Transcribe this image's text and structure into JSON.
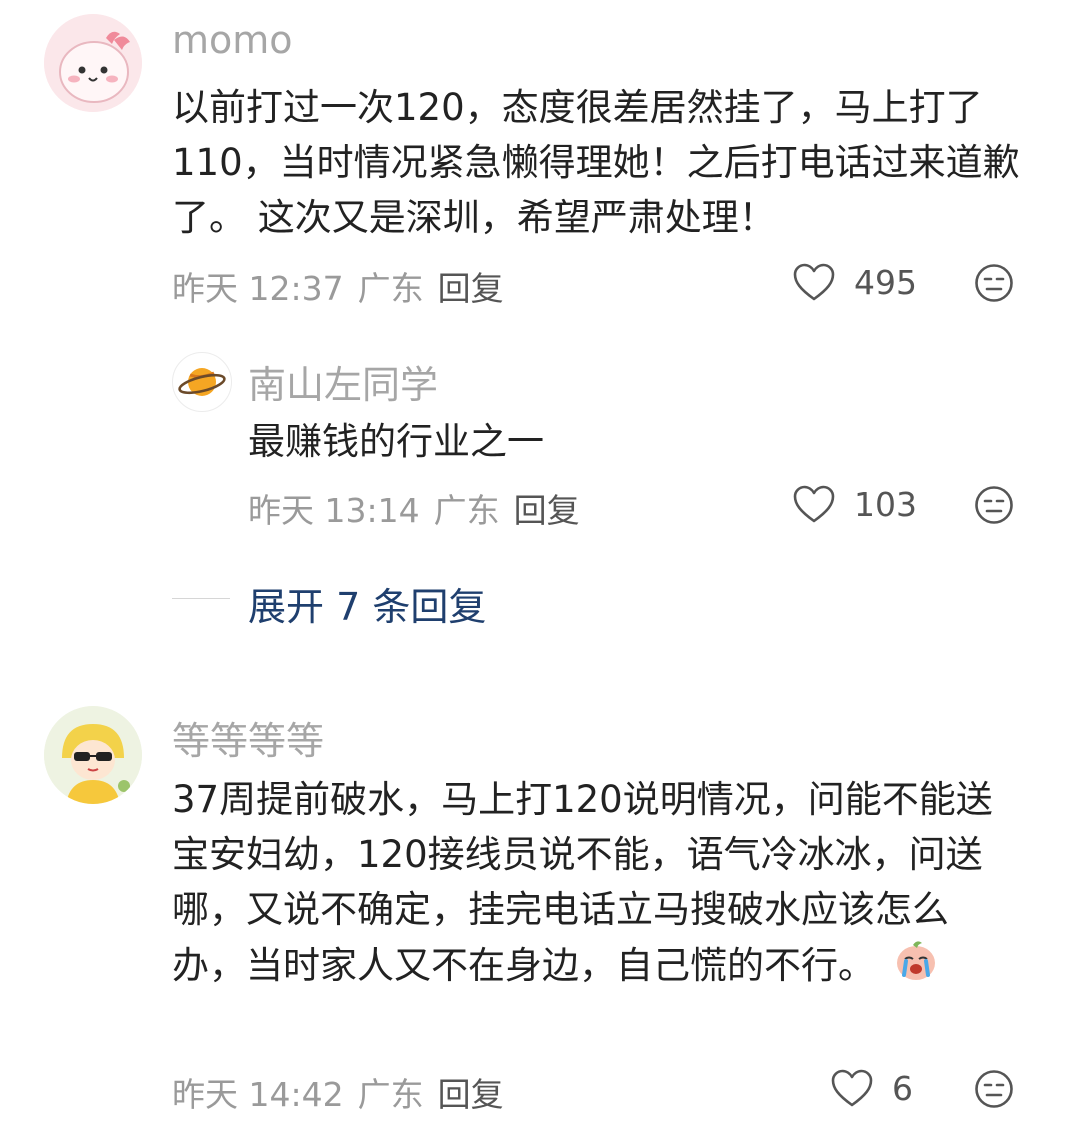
{
  "comments": [
    {
      "username": "momo",
      "content": "以前打过一次120，态度很差居然挂了，马上打了110，当时情况紧急懒得理她！之后打电话过来道歉了。 这次又是深圳，希望严肃处理！",
      "time": "昨天 12:37",
      "location": "广东",
      "reply_label": "回复",
      "likes": "495",
      "replies": [
        {
          "username": "南山左同学",
          "content": "最赚钱的行业之一",
          "time": "昨天 13:14",
          "location": "广东",
          "reply_label": "回复",
          "likes": "103"
        }
      ],
      "expand_label": "展开 7 条回复"
    },
    {
      "username": "等等等等",
      "content": "37周提前破水，马上打120说明情况，问能不能送宝安妇幼，120接线员说不能，语气冷冰冰，问送哪，又说不确定，挂完电话立马搜破水应该怎么办，当时家人又不在身边，自己慌的不行。",
      "time": "昨天 14:42",
      "location": "广东",
      "reply_label": "回复",
      "likes": "6"
    }
  ],
  "icons": {
    "like": "heart-outline-icon",
    "dislike": "unamused-face-icon",
    "crying_emoji": "crying-emoji-icon"
  },
  "colors": {
    "expand_link": "#1f3f6e",
    "username": "#a6a6a6",
    "meta": "#9a9a9a"
  }
}
